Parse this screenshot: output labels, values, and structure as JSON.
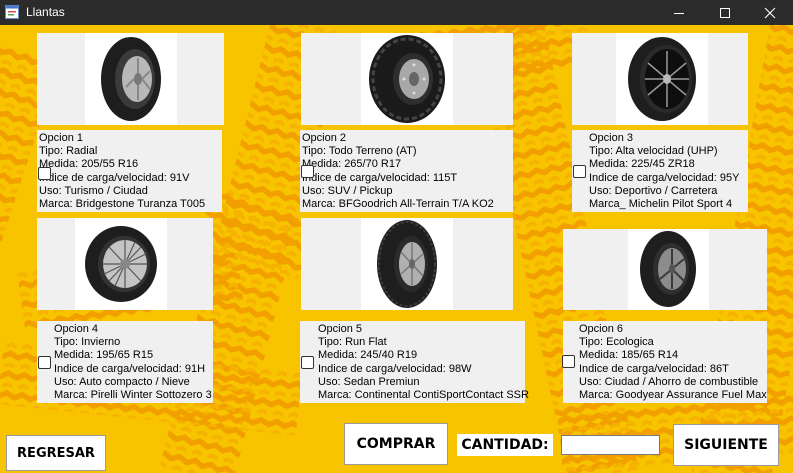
{
  "window": {
    "title": "Llantas"
  },
  "options": [
    {
      "label": "Opcion 1",
      "tipo": "Tipo: Radial",
      "medida": "Medida: 205/55 R16",
      "indice": "Indice de carga/velocidad: 91V",
      "uso": "Uso: Turismo / Ciudad",
      "marca": "Marca: Bridgestone Turanza T005",
      "checked": false,
      "image": "radial-tire-image"
    },
    {
      "label": "Opcion 2",
      "tipo": "Tipo: Todo Terreno (AT)",
      "medida": "Medida: 265/70 R17",
      "indice": "Indice de carga/velocidad: 115T",
      "uso": "Uso: SUV / Pickup",
      "marca": "Marca: BFGoodrich All-Terrain T/A KO2",
      "checked": false,
      "image": "all-terrain-tire-image"
    },
    {
      "label": "Opcion 3",
      "tipo": "Tipo: Alta velocidad (UHP)",
      "medida": "Medida: 225/45 ZR18",
      "indice": "Indice de carga/velocidad: 95Y",
      "uso": "Uso: Deportivo / Carretera",
      "marca": "Marca_ Michelin Pilot Sport 4",
      "checked": false,
      "image": "uhp-tire-image"
    },
    {
      "label": "Opcion 4",
      "tipo": "Tipo: Invierno",
      "medida": "Medida: 195/65 R15",
      "indice": "Indice de carga/velocidad: 91H",
      "uso": "Uso: Auto compacto / Nieve",
      "marca": "Marca: Pirelli Winter Sottozero 3",
      "checked": false,
      "image": "winter-tire-image"
    },
    {
      "label": "Opcion 5",
      "tipo": "Tipo: Run Flat",
      "medida": "Medida: 245/40 R19",
      "indice": "Indice de carga/velocidad: 98W",
      "uso": "Uso: Sedan Premiun",
      "marca": "Marca: Continental ContiSportContact SSR",
      "checked": false,
      "image": "run-flat-tire-image"
    },
    {
      "label": "Opcion 6",
      "tipo": "Tipo: Ecologica",
      "medida": "Medida: 185/65 R14",
      "indice": "Indice de carga/velocidad: 86T",
      "uso": "Uso: Ciudad / Ahorro de combustible",
      "marca": "Marca: Goodyear Assurance Fuel Max",
      "checked": false,
      "image": "eco-tire-image"
    }
  ],
  "buttons": {
    "regresar": "REGRESAR",
    "comprar": "COMPRAR",
    "siguiente": "SIGUIENTE"
  },
  "cantidad": {
    "label": "CANTIDAD:",
    "value": ""
  },
  "colors": {
    "background": "#f8c400",
    "titlebar": "#2b2b2b",
    "panel": "#f0f0f0",
    "tread": "#f2a000"
  },
  "icons": {
    "app": "form-icon",
    "minimize": "minimize-icon",
    "maximize": "maximize-icon",
    "close": "close-icon"
  }
}
